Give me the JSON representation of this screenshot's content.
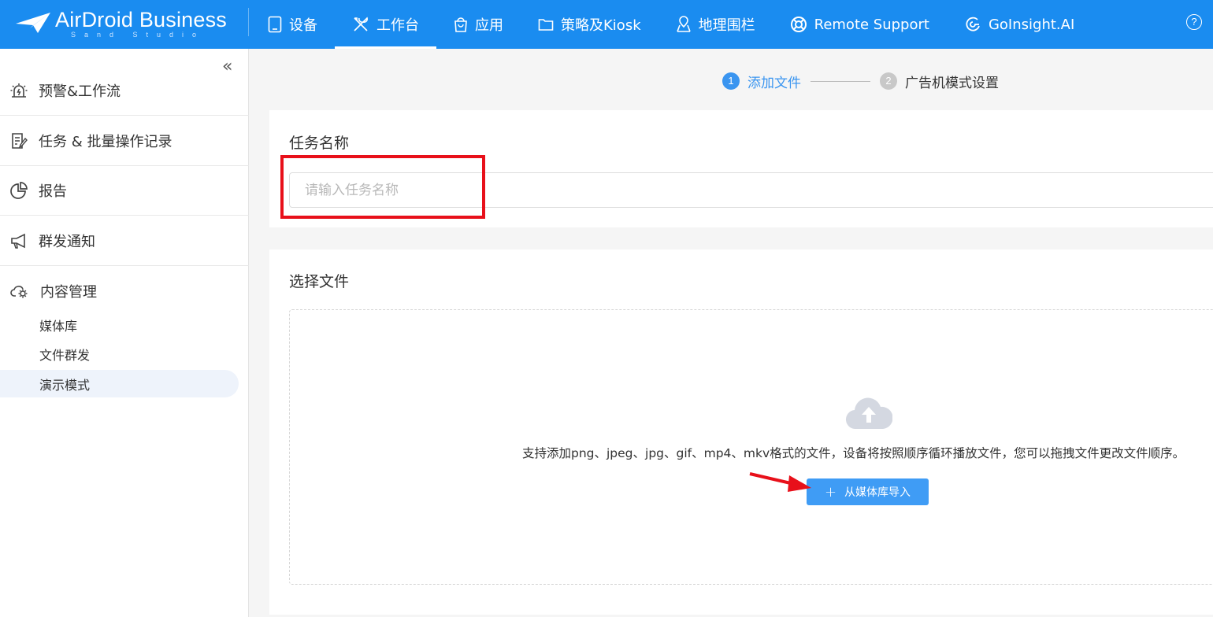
{
  "header": {
    "logo_text": "AirDroid Business",
    "logo_sub": "Sand Studio",
    "nav": [
      {
        "label": "设备",
        "icon": "tablet-icon"
      },
      {
        "label": "工作台",
        "icon": "tools-icon"
      },
      {
        "label": "应用",
        "icon": "shopping-bag-icon"
      },
      {
        "label": "策略及Kiosk",
        "icon": "folder-icon"
      },
      {
        "label": "地理围栏",
        "icon": "map-pin-icon"
      },
      {
        "label": "Remote Support",
        "icon": "lifebuoy-icon"
      },
      {
        "label": "GoInsight.AI",
        "icon": "goinsight-icon"
      }
    ],
    "active_nav": "工作台",
    "help_label": "?"
  },
  "sidebar": {
    "collapse_glyph": "«",
    "items": [
      {
        "label": "预警&工作流",
        "icon": "alarm-icon"
      },
      {
        "label": "任务 & 批量操作记录",
        "icon": "task-list-icon"
      },
      {
        "label": "报告",
        "icon": "pie-chart-icon"
      },
      {
        "label": "群发通知",
        "icon": "megaphone-icon"
      },
      {
        "label": "内容管理",
        "icon": "cloud-gear-icon"
      }
    ],
    "sub_items": [
      {
        "label": "媒体库"
      },
      {
        "label": "文件群发"
      },
      {
        "label": "演示模式"
      }
    ],
    "active_sub": "演示模式"
  },
  "steps": [
    {
      "num": "1",
      "label": "添加文件",
      "state": "active"
    },
    {
      "num": "2",
      "label": "广告机模式设置",
      "state": "pending"
    }
  ],
  "task_name": {
    "title": "任务名称",
    "placeholder": "请输入任务名称",
    "value": ""
  },
  "file_select": {
    "title": "选择文件",
    "hint": "支持添加png、jpeg、jpg、gif、mp4、mkv格式的文件，设备将按照顺序循环播放文件，您可以拖拽文件更改文件顺序。",
    "import_button": "从媒体库导入",
    "import_icon": "plus-icon",
    "upload_icon": "cloud-upload-icon"
  },
  "colors": {
    "primary": "#1a8cf0",
    "button": "#3f9cf5",
    "annotation_red": "#e8101a"
  }
}
